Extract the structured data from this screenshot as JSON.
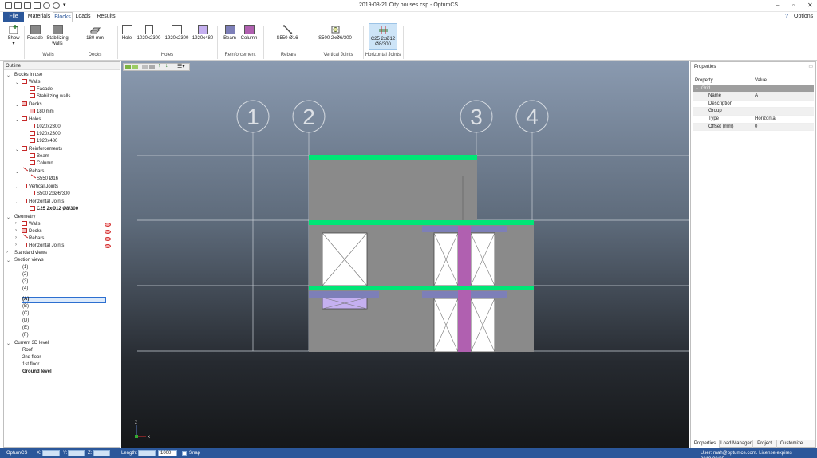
{
  "window": {
    "title": "2019-08-21 City houses.csp - OptumCS",
    "minimize": "–",
    "maximize": "▫",
    "close": "✕",
    "help": "?",
    "options": "Options"
  },
  "menu": {
    "tabs": [
      {
        "label": "File"
      },
      {
        "label": "Materials"
      },
      {
        "label": "Blocks"
      },
      {
        "label": "Loads"
      },
      {
        "label": "Results"
      }
    ]
  },
  "ribbon": {
    "show": {
      "label": "Show"
    },
    "walls": [
      {
        "label": "Facade"
      },
      {
        "label": "Stabilizing walls"
      }
    ],
    "decks": [
      {
        "label": "180 mm"
      }
    ],
    "holes": [
      {
        "label": "Hole"
      },
      {
        "label": "1020x2300"
      },
      {
        "label": "1920x2300"
      },
      {
        "label": "1920x480"
      }
    ],
    "reinforcement": [
      {
        "label": "Beam"
      },
      {
        "label": "Column"
      }
    ],
    "rebars": [
      {
        "label": "S550 Ø16"
      }
    ],
    "vjoints": [
      {
        "label": "S500 2xØ6/300"
      }
    ],
    "hjoints": [
      {
        "label": "C25  2xØ12 Ø8/300"
      }
    ],
    "groups": [
      {
        "label": "Walls"
      },
      {
        "label": "Decks"
      },
      {
        "label": "Holes"
      },
      {
        "label": "Reinforcement"
      },
      {
        "label": "Rebars"
      },
      {
        "label": "Vertical Joints"
      },
      {
        "label": "Horizontal Joints"
      }
    ]
  },
  "outline": {
    "title": "Outline",
    "items": [
      {
        "label": "Blocks in use"
      },
      {
        "label": "Walls"
      },
      {
        "label": "Facade"
      },
      {
        "label": "Stabilizing walls"
      },
      {
        "label": "Decks"
      },
      {
        "label": "180 mm"
      },
      {
        "label": "Holes"
      },
      {
        "label": "1020x2300"
      },
      {
        "label": "1920x2300"
      },
      {
        "label": "1920x480"
      },
      {
        "label": "Reinforcements"
      },
      {
        "label": "Beam"
      },
      {
        "label": "Column"
      },
      {
        "label": "Rebars"
      },
      {
        "label": "S550 Ø16"
      },
      {
        "label": "Vertical Joints"
      },
      {
        "label": "S500 2xØ6/300"
      },
      {
        "label": "Horizontal Joints"
      },
      {
        "label": "C25  2xØ12  Ø8/300"
      },
      {
        "label": "Geometry"
      },
      {
        "label": "Walls"
      },
      {
        "label": "Decks"
      },
      {
        "label": "Rebars"
      },
      {
        "label": "Horizontal Joints"
      },
      {
        "label": "Standard views"
      },
      {
        "label": "Section views"
      },
      {
        "label": "(1)"
      },
      {
        "label": "(2)"
      },
      {
        "label": "(3)"
      },
      {
        "label": "(4)"
      },
      {
        "label": "(A)"
      },
      {
        "label": "(B)"
      },
      {
        "label": "(C)"
      },
      {
        "label": "(D)"
      },
      {
        "label": "(E)"
      },
      {
        "label": "(F)"
      },
      {
        "label": "Current 3D level"
      },
      {
        "label": "Roof"
      },
      {
        "label": "2nd floor"
      },
      {
        "label": "1st floor"
      },
      {
        "label": "Ground level"
      }
    ]
  },
  "viewport": {
    "grid_labels": [
      "1",
      "2",
      "3",
      "4"
    ],
    "axis": {
      "z": "z",
      "x": "x"
    }
  },
  "properties": {
    "title": "Properties",
    "col_property": "Property",
    "col_value": "Value",
    "group": "Grid",
    "rows": [
      {
        "name": "Name",
        "value": "A"
      },
      {
        "name": "Description",
        "value": ""
      },
      {
        "name": "Group",
        "value": ""
      },
      {
        "name": "Type",
        "value": "Horizontal"
      },
      {
        "name": "Offset (mm)",
        "value": "0"
      }
    ],
    "tabs": [
      {
        "label": "Properties"
      },
      {
        "label": "Load Manager"
      },
      {
        "label": "Project"
      },
      {
        "label": "Customize"
      }
    ]
  },
  "status": {
    "app": "OptumCS",
    "x_label": "X:",
    "y_label": "Y:",
    "z_label": "Z:",
    "length_label": "Length:",
    "scale": "1000",
    "snap": "Snap",
    "license": "User: mah@optumce.com. License expires 2019/09/05"
  },
  "colors": {
    "accent": "#2b579a",
    "deck": "#00e676",
    "wall": "#8a8a8a",
    "column": "#b060b0",
    "beam": "#7d7fb8",
    "hole_small": "#c5b0f0"
  }
}
